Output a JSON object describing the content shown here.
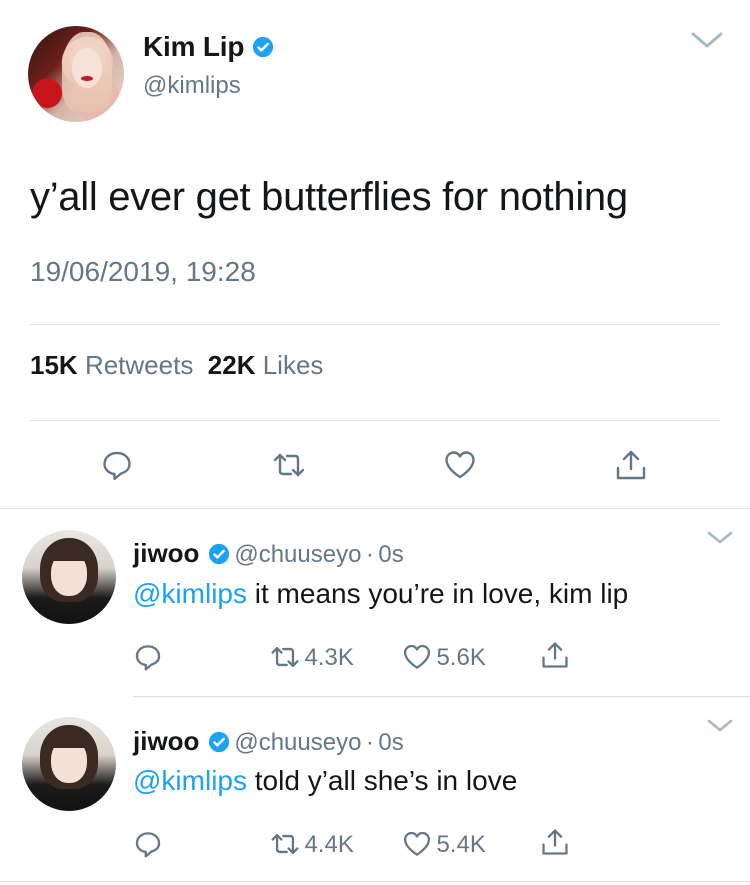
{
  "main_tweet": {
    "author_name": "Kim Lip",
    "author_handle": "@kimlips",
    "text": "y’all ever get butterflies for nothing",
    "timestamp": "19/06/2019, 19:28",
    "retweets_count": "15K",
    "retweets_label": "Retweets",
    "likes_count": "22K",
    "likes_label": "Likes"
  },
  "replies": [
    {
      "author_name": "jiwoo",
      "author_handle": "@chuuseyo",
      "separator": "·",
      "time": "0s",
      "mention": "@kimlips",
      "text": " it means you’re in love, kim lip",
      "retweets": "4.3K",
      "likes": "5.6K"
    },
    {
      "author_name": "jiwoo",
      "author_handle": "@chuuseyo",
      "separator": "·",
      "time": "0s",
      "mention": "@kimlips",
      "text": " told y’all she’s in love",
      "retweets": "4.4K",
      "likes": "5.4K"
    }
  ],
  "colors": {
    "accent": "#1da1f2",
    "text": "#14171a",
    "secondary": "#657786",
    "divider": "#d9dee2"
  },
  "icons": [
    "verified-icon",
    "chevron-down-icon",
    "reply-icon",
    "retweet-icon",
    "like-icon",
    "share-icon"
  ]
}
